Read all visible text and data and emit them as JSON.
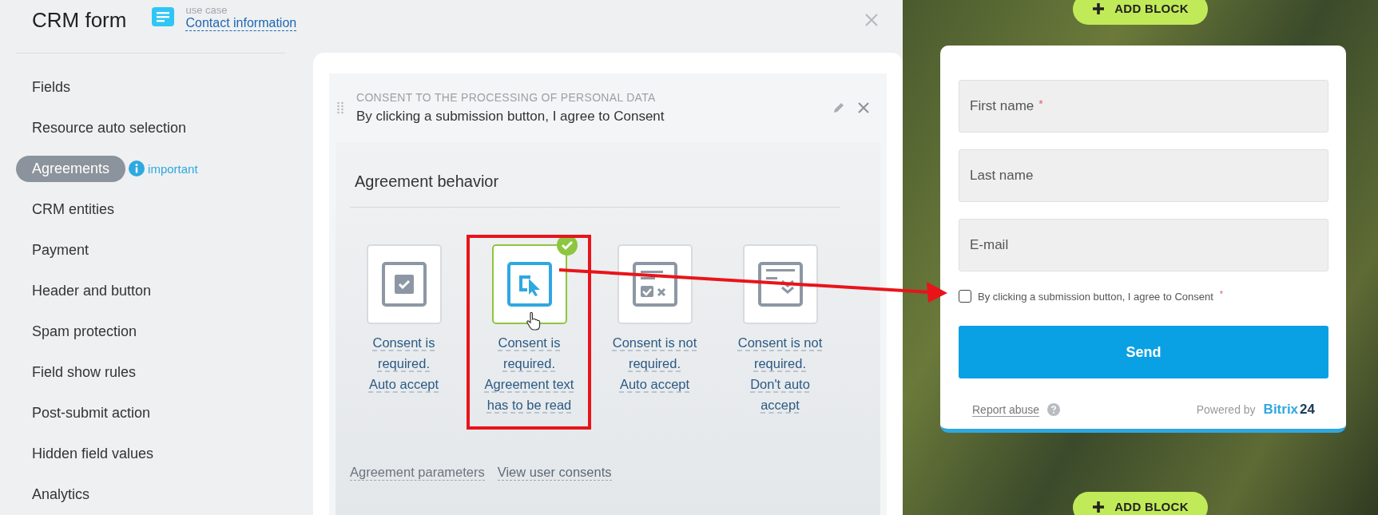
{
  "header": {
    "title": "CRM form",
    "use_case_label": "use case",
    "use_case_link": "Contact information"
  },
  "sidebar": {
    "items": [
      {
        "label": "Fields",
        "selected": false
      },
      {
        "label": "Resource auto selection",
        "selected": false
      },
      {
        "label": "Agreements",
        "selected": true,
        "badge": "important"
      },
      {
        "label": "CRM entities",
        "selected": false
      },
      {
        "label": "Payment",
        "selected": false
      },
      {
        "label": "Header and button",
        "selected": false
      },
      {
        "label": "Spam protection",
        "selected": false
      },
      {
        "label": "Field show rules",
        "selected": false
      },
      {
        "label": "Post-submit action",
        "selected": false
      },
      {
        "label": "Hidden field values",
        "selected": false
      },
      {
        "label": "Analytics",
        "selected": false
      }
    ]
  },
  "agreement": {
    "caption": "CONSENT TO THE PROCESSING OF PERSONAL DATA",
    "text": "By clicking a submission button, I agree to Consent",
    "behavior_title": "Agreement behavior",
    "options": [
      {
        "kind": "checkbox",
        "label": "Consent is\nrequired.\nAuto accept",
        "selected": false
      },
      {
        "kind": "pointer",
        "label": "Consent is\nrequired.\nAgreement text\nhas to be read",
        "selected": true
      },
      {
        "kind": "check-cross",
        "label": "Consent is not\nrequired.\nAuto accept",
        "selected": false
      },
      {
        "kind": "scroll-down",
        "label": "Consent is not\nrequired.\nDon't auto\naccept",
        "selected": false
      }
    ],
    "links": [
      "Agreement parameters",
      "View user consents"
    ]
  },
  "preview": {
    "add_block_buttons": [
      "ADD BLOCK",
      "ADD BLOCK"
    ],
    "fields": [
      {
        "placeholder": "First name",
        "required": true
      },
      {
        "placeholder": "Last name",
        "required": false
      },
      {
        "placeholder": "E-mail",
        "required": false
      }
    ],
    "consent": {
      "label": "By clicking a submission button, I agree to Consent",
      "required": true,
      "checked": false
    },
    "required_mark": "*",
    "send_button": "Send",
    "report_abuse": "Report abuse",
    "powered_by": "Powered by",
    "brand": "Bitrix",
    "brand_number": "24"
  }
}
